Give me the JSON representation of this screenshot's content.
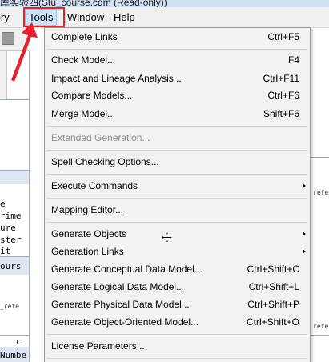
{
  "window": {
    "title": "库实验四(Stu_course.cdm (Read-only))"
  },
  "menubar": {
    "items": [
      {
        "label": "tory"
      },
      {
        "label": "Tools"
      },
      {
        "label": "Window"
      },
      {
        "label": "Help"
      }
    ]
  },
  "background": {
    "left_text": [
      "e",
      "rime",
      "ure",
      "ster",
      "it",
      "ours",
      "_refe",
      "c",
      "Numbe"
    ],
    "right_text": [
      "refe",
      "refe"
    ]
  },
  "tools_menu": {
    "items": [
      {
        "label": "Complete Links",
        "shortcut": "Ctrl+F5"
      },
      {
        "label": "Check Model...",
        "shortcut": "F4"
      },
      {
        "label": "Impact and Lineage Analysis...",
        "shortcut": "Ctrl+F11"
      },
      {
        "label": "Compare Models...",
        "shortcut": "Ctrl+F6"
      },
      {
        "label": "Merge Model...",
        "shortcut": "Shift+F6"
      },
      {
        "label": "Extended Generation...",
        "shortcut": "",
        "disabled": true
      },
      {
        "label": "Spell Checking Options...",
        "shortcut": ""
      },
      {
        "label": "Execute Commands",
        "shortcut": "",
        "submenu": true
      },
      {
        "label": "Mapping Editor...",
        "shortcut": ""
      },
      {
        "label": "Generate Objects",
        "shortcut": "",
        "submenu": true
      },
      {
        "label": "Generation Links",
        "shortcut": "",
        "submenu": true
      },
      {
        "label": "Generate Conceptual Data Model...",
        "shortcut": "Ctrl+Shift+C"
      },
      {
        "label": "Generate Logical Data Model...",
        "shortcut": "Ctrl+Shift+L"
      },
      {
        "label": "Generate Physical Data Model...",
        "shortcut": "Ctrl+Shift+P"
      },
      {
        "label": "Generate Object-Oriented Model...",
        "shortcut": "Ctrl+Shift+O"
      },
      {
        "label": "License Parameters...",
        "shortcut": ""
      }
    ]
  },
  "colors": {
    "annotation_red": "#e8212c",
    "menu_background": "#f2f2f2",
    "disabled_text": "#8c8c8c",
    "menubar_hover": "#cce4f7"
  },
  "icons": [
    "submenu-arrow-icon",
    "move-cursor-icon",
    "annotation-arrow-icon"
  ]
}
